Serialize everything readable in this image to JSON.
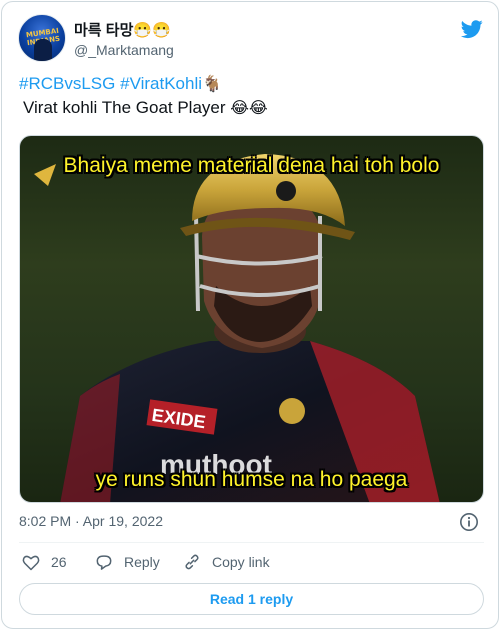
{
  "tweet": {
    "display_name": "마륵 타망😷😷",
    "handle": "@_Marktamang",
    "avatar_text": "MUMBAI INDIANS",
    "hashtags": [
      "#RCBvsLSG",
      "#ViratKohli"
    ],
    "hashtag_emoji": "🐐",
    "text": "Virat kohli The Goat Player",
    "text_emoji": "😂😂",
    "media": {
      "caption_top": "Bhaiya meme material dena hai toh bolo",
      "caption_bottom": "ye runs shun humse na ho paega",
      "jersey_text": "EXIDE",
      "sponsor_text": "muthoot"
    },
    "timestamp": "8:02 PM · Apr 19, 2022",
    "likes": "26",
    "reply_label": "Reply",
    "copy_link_label": "Copy link",
    "read_replies_label": "Read 1 reply"
  },
  "colors": {
    "accent": "#1d9bf0",
    "muted": "#536471",
    "caption_yellow": "#fff32a"
  },
  "icons": [
    "twitter-bird-icon",
    "info-icon",
    "heart-icon",
    "reply-icon",
    "link-icon"
  ]
}
